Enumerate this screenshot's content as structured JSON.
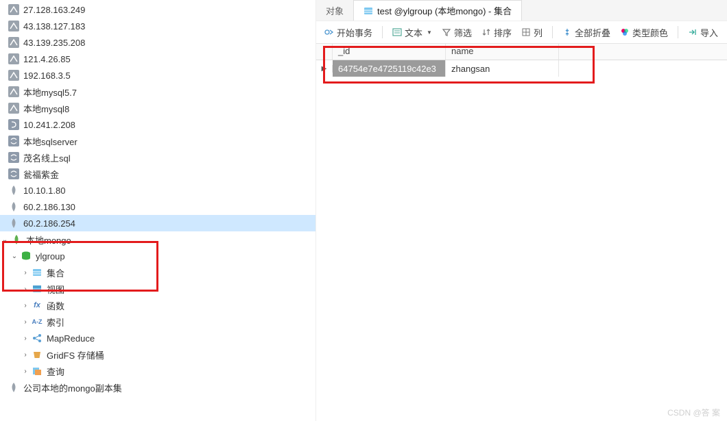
{
  "sidebar": {
    "servers": [
      {
        "label": "27.128.163.249",
        "icon": "db"
      },
      {
        "label": "43.138.127.183",
        "icon": "db"
      },
      {
        "label": "43.139.235.208",
        "icon": "db"
      },
      {
        "label": "121.4.26.85",
        "icon": "db"
      },
      {
        "label": "192.168.3.5",
        "icon": "db"
      },
      {
        "label": "本地mysql5.7",
        "icon": "db"
      },
      {
        "label": "本地mysql8",
        "icon": "db"
      },
      {
        "label": "10.241.2.208",
        "icon": "pg"
      },
      {
        "label": "本地sqlserver",
        "icon": "ss"
      },
      {
        "label": "茂名线上sql",
        "icon": "ss"
      },
      {
        "label": "瓮福紫金",
        "icon": "ss"
      },
      {
        "label": "10.10.1.80",
        "icon": "mg"
      },
      {
        "label": "60.2.186.130",
        "icon": "mg"
      },
      {
        "label": "60.2.186.254",
        "icon": "mg",
        "selected": true
      },
      {
        "label": "本地mongo",
        "icon": "mg",
        "expanded": true
      }
    ],
    "activeDb": {
      "name": "ylgroup",
      "children": [
        {
          "label": "集合",
          "icon": "coll"
        },
        {
          "label": "视图",
          "icon": "view"
        },
        {
          "label": "函数",
          "icon": "fx"
        },
        {
          "label": "索引",
          "icon": "az"
        },
        {
          "label": "MapReduce",
          "icon": "mr"
        },
        {
          "label": "GridFS 存储桶",
          "icon": "grid"
        },
        {
          "label": "查询",
          "icon": "query"
        }
      ]
    },
    "trailing": {
      "label": "公司本地的mongo副本集",
      "icon": "mg"
    }
  },
  "tabs": {
    "items": [
      {
        "label": "对象",
        "active": false
      },
      {
        "label": "test @ylgroup (本地mongo) - 集合",
        "active": true
      }
    ]
  },
  "toolbar": {
    "begin": "开始事务",
    "text": "文本",
    "filter": "筛选",
    "sort": "排序",
    "columns": "列",
    "collapse": "全部折叠",
    "colors": "类型颜色",
    "import": "导入"
  },
  "grid": {
    "headers": {
      "id": "_id",
      "name": "name"
    },
    "rows": [
      {
        "id": "64754e7e4725119c42e3",
        "name": "zhangsan"
      }
    ]
  },
  "watermark": "CSDN @答 案"
}
